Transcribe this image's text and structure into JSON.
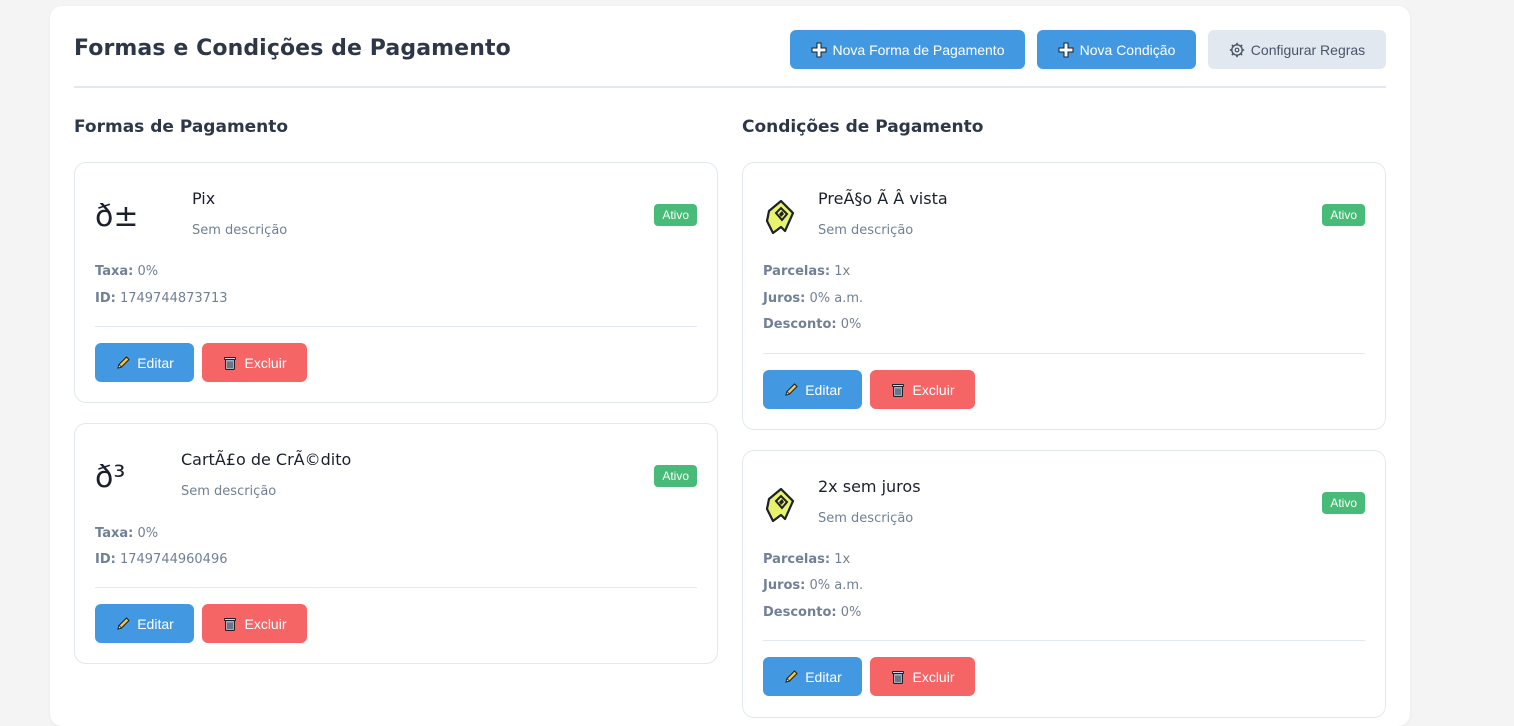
{
  "header": {
    "title": "Formas e Condições de Pagamento",
    "btn_new_payment": "Nova Forma de Pagamento",
    "btn_new_condition": "Nova Condição",
    "btn_rules": "Configurar Regras"
  },
  "payment_methods": {
    "title": "Formas de Pagamento",
    "labels": {
      "fee": "Taxa:",
      "id": "ID:"
    },
    "items": [
      {
        "icon_text": "ð±",
        "name": "Pix",
        "description": "Sem descrição",
        "status": "Ativo",
        "fee": "0%",
        "id": "1749744873713",
        "edit_label": "Editar",
        "delete_label": "Excluir"
      },
      {
        "icon_text": "ð³",
        "name": "CartÃ£o de CrÃ©dito",
        "description": "Sem descrição",
        "status": "Ativo",
        "fee": "0%",
        "id": "1749744960496",
        "edit_label": "Editar",
        "delete_label": "Excluir"
      }
    ]
  },
  "payment_conditions": {
    "title": "Condições de Pagamento",
    "labels": {
      "installments": "Parcelas:",
      "interest": "Juros:",
      "discount": "Desconto:"
    },
    "items": [
      {
        "icon": "payment-condition-icon",
        "name": "PreÃ§o Ã Â vista",
        "description": "Sem descrição",
        "status": "Ativo",
        "installments": "1x",
        "interest": "0% a.m.",
        "discount": "0%",
        "edit_label": "Editar",
        "delete_label": "Excluir"
      },
      {
        "icon": "payment-condition-icon",
        "name": "2x sem juros",
        "description": "Sem descrição",
        "status": "Ativo",
        "installments": "1x",
        "interest": "0% a.m.",
        "discount": "0%",
        "edit_label": "Editar",
        "delete_label": "Excluir"
      }
    ]
  },
  "colors": {
    "primary": "#4299e1",
    "danger": "#f56565",
    "success": "#48bb78",
    "muted": "#718096",
    "secondary": "#e2e8f0"
  }
}
